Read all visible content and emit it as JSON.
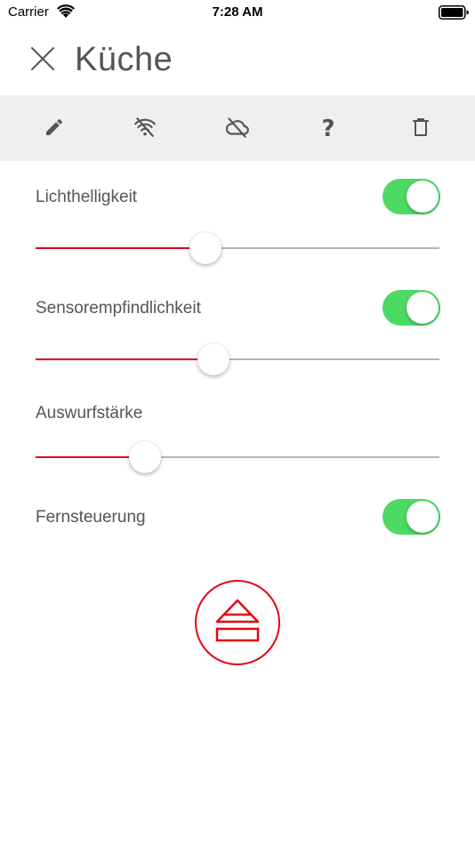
{
  "status_bar": {
    "carrier": "Carrier",
    "time": "7:28 AM",
    "icons": [
      "wifi-icon",
      "battery-icon"
    ]
  },
  "header": {
    "close_icon": "close-icon",
    "title": "Küche"
  },
  "toolbar": {
    "items": [
      {
        "icon": "pencil-icon"
      },
      {
        "icon": "wifi-off-icon"
      },
      {
        "icon": "cloud-off-icon"
      },
      {
        "icon": "help-icon",
        "glyph": "?"
      },
      {
        "icon": "trash-icon"
      }
    ]
  },
  "settings": {
    "lichthelligkeit": {
      "label": "Lichthelligkeit",
      "enabled": true,
      "value_fraction": 0.42
    },
    "sensorempfindlichkeit": {
      "label": "Sensorempfindlichkeit",
      "enabled": true,
      "value_fraction": 0.44
    },
    "auswurfstaerke": {
      "label": "Auswurfstärke",
      "value_fraction": 0.27
    },
    "fernsteuerung": {
      "label": "Fernsteuerung",
      "enabled": true
    }
  },
  "eject_button": {
    "icon": "eject-icon"
  },
  "colors": {
    "accent": "#e30613",
    "toggle_on": "#4cd964",
    "text": "#555555",
    "toolbar_bg": "#efefef",
    "track": "#b5b5b5"
  }
}
